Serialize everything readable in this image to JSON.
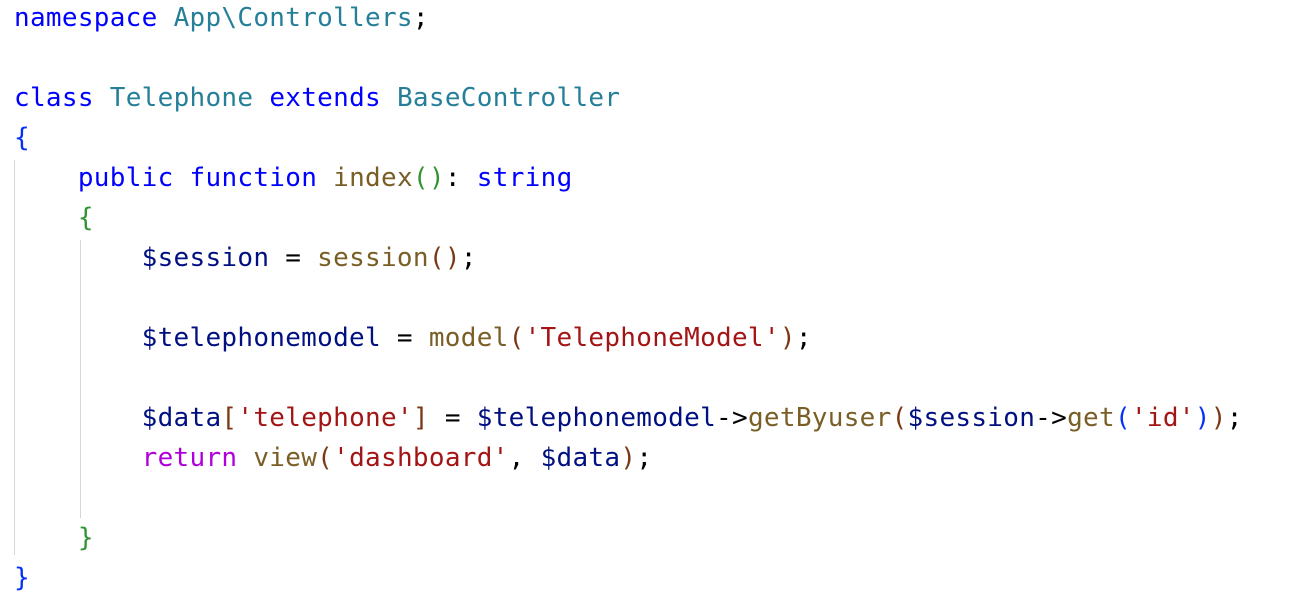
{
  "code": {
    "l1": {
      "kw_namespace": "namespace",
      "ns_name": "App\\Controllers",
      "semi": ";"
    },
    "l3": {
      "kw_class": "class",
      "class_name": "Telephone",
      "kw_extends": "extends",
      "base_class": "BaseController"
    },
    "l4": {
      "brace_open": "{"
    },
    "l5": {
      "kw_public": "public",
      "kw_function": "function",
      "fn_name": "index",
      "paren_open": "(",
      "paren_close": ")",
      "colon": ":",
      "return_type": "string"
    },
    "l6": {
      "brace_open": "{"
    },
    "l7": {
      "var_session": "$session",
      "assign": " = ",
      "fn_session": "session",
      "paren_open": "(",
      "paren_close": ")",
      "semi": ";"
    },
    "l9": {
      "var_model": "$telephonemodel",
      "assign": " = ",
      "fn_model": "model",
      "paren_open": "(",
      "str_model": "'TelephoneModel'",
      "paren_close": ")",
      "semi": ";"
    },
    "l11": {
      "var_data": "$data",
      "bracket_open": "[",
      "str_key": "'telephone'",
      "bracket_close": "]",
      "assign": " = ",
      "var_model": "$telephonemodel",
      "arrow1": "->",
      "fn_get_by_user": "getByuser",
      "paren1_open": "(",
      "var_session": "$session",
      "arrow2": "->",
      "fn_get": "get",
      "paren2_open": "(",
      "str_id": "'id'",
      "paren2_close": ")",
      "paren1_close": ")",
      "semi": ";"
    },
    "l12": {
      "kw_return": "return",
      "fn_view": "view",
      "paren_open": "(",
      "str_view": "'dashboard'",
      "comma": ", ",
      "var_data": "$data",
      "paren_close": ")",
      "semi": ";"
    },
    "l14": {
      "brace_close": "}"
    },
    "l15": {
      "brace_close": "}"
    }
  },
  "colors": {
    "keyword": "#0000ff",
    "control_keyword": "#af00db",
    "type": "#267f99",
    "function": "#795e26",
    "variable": "#001080",
    "string": "#a31515",
    "bracket_level_1": "#0431fa",
    "bracket_level_2": "#319331",
    "bracket_level_3": "#7b3814"
  }
}
